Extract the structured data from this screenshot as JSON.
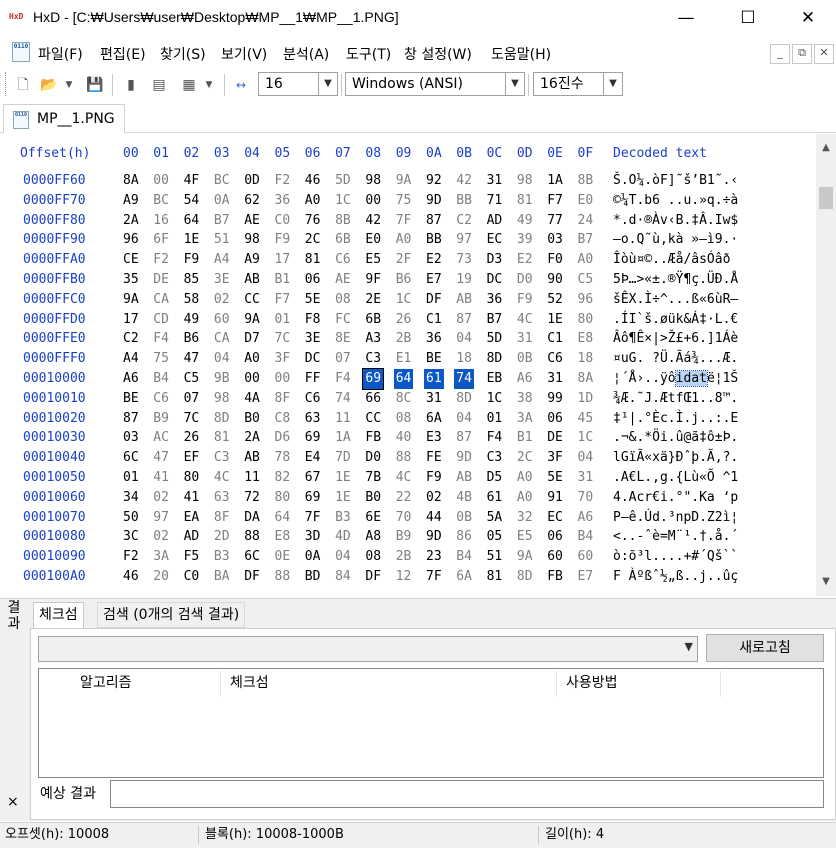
{
  "window": {
    "title": "HxD - [C:₩Users₩user₩Desktop₩MP__1₩MP__1.PNG]",
    "app_icon_text": "HxD",
    "controls": {
      "minimize": "—",
      "maximize": "☐",
      "close": "✕"
    }
  },
  "menu": {
    "icon_text": "0110",
    "items": [
      "파일(F)",
      "편집(E)",
      "찾기(S)",
      "보기(V)",
      "분석(A)",
      "도구(T)",
      "창 설정(W)",
      "도움말(H)"
    ],
    "mdi": {
      "minimize": "_",
      "restore": "⧉",
      "close": "✕"
    }
  },
  "toolbar": {
    "bytes_per_row": "16",
    "charset": "Windows (ANSI)",
    "offset_base": "16진수",
    "icons": [
      "new-file-icon",
      "open-folder-icon",
      "save-icon",
      "cut-icon",
      "copy-icon",
      "paste-icon",
      "columns-width-icon"
    ]
  },
  "file_tab": {
    "icon_text": "0110",
    "label": "MP__1.PNG"
  },
  "hex": {
    "header_offset": "Offset(h)",
    "header_columns": [
      "00",
      "01",
      "02",
      "03",
      "04",
      "05",
      "06",
      "07",
      "08",
      "09",
      "0A",
      "0B",
      "0C",
      "0D",
      "0E",
      "0F"
    ],
    "header_decoded": "Decoded text",
    "rows": [
      {
        "offset": "0000FF60",
        "bytes": [
          "8A",
          "00",
          "4F",
          "BC",
          "0D",
          "F2",
          "46",
          "5D",
          "98",
          "9A",
          "92",
          "42",
          "31",
          "98",
          "1A",
          "8B"
        ],
        "text": "Š.O¼.òF]˜š’B1˜.‹"
      },
      {
        "offset": "0000FF70",
        "bytes": [
          "A9",
          "BC",
          "54",
          "0A",
          "62",
          "36",
          "A0",
          "1C",
          "00",
          "75",
          "9D",
          "BB",
          "71",
          "81",
          "F7",
          "E0"
        ],
        "text": "©¼T.b6 ..u.»q.÷à"
      },
      {
        "offset": "0000FF80",
        "bytes": [
          "2A",
          "16",
          "64",
          "B7",
          "AE",
          "C0",
          "76",
          "8B",
          "42",
          "7F",
          "87",
          "C2",
          "AD",
          "49",
          "77",
          "24"
        ],
        "text": "*.d·®Àv‹B.‡Â.Iw$"
      },
      {
        "offset": "0000FF90",
        "bytes": [
          "96",
          "6F",
          "1E",
          "51",
          "98",
          "F9",
          "2C",
          "6B",
          "E0",
          "A0",
          "BB",
          "97",
          "EC",
          "39",
          "03",
          "B7"
        ],
        "text": "–o.Q˜ù,kà »—ì9.·"
      },
      {
        "offset": "0000FFA0",
        "bytes": [
          "CE",
          "F2",
          "F9",
          "A4",
          "A9",
          "17",
          "81",
          "C6",
          "E5",
          "2F",
          "E2",
          "73",
          "D3",
          "E2",
          "F0",
          "A0"
        ],
        "text": "Îòù¤©..Æå/âsÓâð "
      },
      {
        "offset": "0000FFB0",
        "bytes": [
          "35",
          "DE",
          "85",
          "3E",
          "AB",
          "B1",
          "06",
          "AE",
          "9F",
          "B6",
          "E7",
          "19",
          "DC",
          "D0",
          "90",
          "C5"
        ],
        "text": "5Þ…>«±.®Ÿ¶ç.ÜÐ.Å"
      },
      {
        "offset": "0000FFC0",
        "bytes": [
          "9A",
          "CA",
          "58",
          "02",
          "CC",
          "F7",
          "5E",
          "08",
          "2E",
          "1C",
          "DF",
          "AB",
          "36",
          "F9",
          "52",
          "96"
        ],
        "text": "šÊX.Ì÷^...ß«6ùR–"
      },
      {
        "offset": "0000FFD0",
        "bytes": [
          "17",
          "CD",
          "49",
          "60",
          "9A",
          "01",
          "F8",
          "FC",
          "6B",
          "26",
          "C1",
          "87",
          "B7",
          "4C",
          "1E",
          "80"
        ],
        "text": ".ÍI`š.øük&Á‡·L.€"
      },
      {
        "offset": "0000FFE0",
        "bytes": [
          "C2",
          "F4",
          "B6",
          "CA",
          "D7",
          "7C",
          "3E",
          "8E",
          "A3",
          "2B",
          "36",
          "04",
          "5D",
          "31",
          "C1",
          "E8"
        ],
        "text": "Âô¶Ê×|>Ž£+6.]1Áè"
      },
      {
        "offset": "0000FFF0",
        "bytes": [
          "A4",
          "75",
          "47",
          "04",
          "A0",
          "3F",
          "DC",
          "07",
          "C3",
          "E1",
          "BE",
          "18",
          "8D",
          "0B",
          "C6",
          "18"
        ],
        "text": "¤uG. ?Ü.Ãá¾...Æ."
      },
      {
        "offset": "00010000",
        "bytes": [
          "A6",
          "B4",
          "C5",
          "9B",
          "00",
          "00",
          "FF",
          "F4",
          "69",
          "64",
          "61",
          "74",
          "EB",
          "A6",
          "31",
          "8A"
        ],
        "text": "¦´Å›..ÿôidatë¦1Š"
      },
      {
        "offset": "00010010",
        "bytes": [
          "BE",
          "C6",
          "07",
          "98",
          "4A",
          "8F",
          "C6",
          "74",
          "66",
          "8C",
          "31",
          "8D",
          "1C",
          "38",
          "99",
          "1D"
        ],
        "text": "¾Æ.˜J.ÆtfŒ1..8™."
      },
      {
        "offset": "00010020",
        "bytes": [
          "87",
          "B9",
          "7C",
          "8D",
          "B0",
          "C8",
          "63",
          "11",
          "CC",
          "08",
          "6A",
          "04",
          "01",
          "3A",
          "06",
          "45"
        ],
        "text": "‡¹|.°Èc.Ì.j..:.E"
      },
      {
        "offset": "00010030",
        "bytes": [
          "03",
          "AC",
          "26",
          "81",
          "2A",
          "D6",
          "69",
          "1A",
          "FB",
          "40",
          "E3",
          "87",
          "F4",
          "B1",
          "DE",
          "1C"
        ],
        "text": ".¬&.*Öi.û@ã‡ô±Þ."
      },
      {
        "offset": "00010040",
        "bytes": [
          "6C",
          "47",
          "EF",
          "C3",
          "AB",
          "78",
          "E4",
          "7D",
          "D0",
          "88",
          "FE",
          "9D",
          "C3",
          "2C",
          "3F",
          "04"
        ],
        "text": "lGïÃ«xä}Ðˆþ.Ã,?."
      },
      {
        "offset": "00010050",
        "bytes": [
          "01",
          "41",
          "80",
          "4C",
          "11",
          "82",
          "67",
          "1E",
          "7B",
          "4C",
          "F9",
          "AB",
          "D5",
          "A0",
          "5E",
          "31"
        ],
        "text": ".A€L.‚g.{Lù«Õ ^1"
      },
      {
        "offset": "00010060",
        "bytes": [
          "34",
          "02",
          "41",
          "63",
          "72",
          "80",
          "69",
          "1E",
          "B0",
          "22",
          "02",
          "4B",
          "61",
          "A0",
          "91",
          "70"
        ],
        "text": "4.Acr€i.°\".Ka ‘p"
      },
      {
        "offset": "00010070",
        "bytes": [
          "50",
          "97",
          "EA",
          "8F",
          "DA",
          "64",
          "7F",
          "B3",
          "6E",
          "70",
          "44",
          "0B",
          "5A",
          "32",
          "EC",
          "A6"
        ],
        "text": "P—ê.Úd.³npD.Z2ì¦"
      },
      {
        "offset": "00010080",
        "bytes": [
          "3C",
          "02",
          "AD",
          "2D",
          "88",
          "E8",
          "3D",
          "4D",
          "A8",
          "B9",
          "9D",
          "86",
          "05",
          "E5",
          "06",
          "B4"
        ],
        "text": "<..-ˆè=M¨¹.†.å.´"
      },
      {
        "offset": "00010090",
        "bytes": [
          "F2",
          "3A",
          "F5",
          "B3",
          "6C",
          "0E",
          "0A",
          "04",
          "08",
          "2B",
          "23",
          "B4",
          "51",
          "9A",
          "60",
          "60"
        ],
        "text": "ò:õ³l....+#´Qš``"
      },
      {
        "offset": "000100A0",
        "bytes": [
          "46",
          "20",
          "C0",
          "BA",
          "DF",
          "88",
          "BD",
          "84",
          "DF",
          "12",
          "7F",
          "6A",
          "81",
          "8D",
          "FB",
          "E7"
        ],
        "text": "F Àºßˆ½„ß..j..ûç"
      }
    ]
  },
  "panel": {
    "side_label": "결과",
    "close_glyph": "×",
    "tabs": [
      "체크섬",
      "검색 (0개의 검색 결과)"
    ],
    "algorithm_value": "",
    "refresh_button": "새로고침",
    "columns": [
      "알고리즘",
      "체크섬",
      "사용방법"
    ],
    "expected_label": "예상 결과",
    "expected_value": ""
  },
  "status": {
    "offset": "오프셋(h): 10008",
    "block": "블록(h): 10008-1000B",
    "length": "길이(h): 4"
  }
}
